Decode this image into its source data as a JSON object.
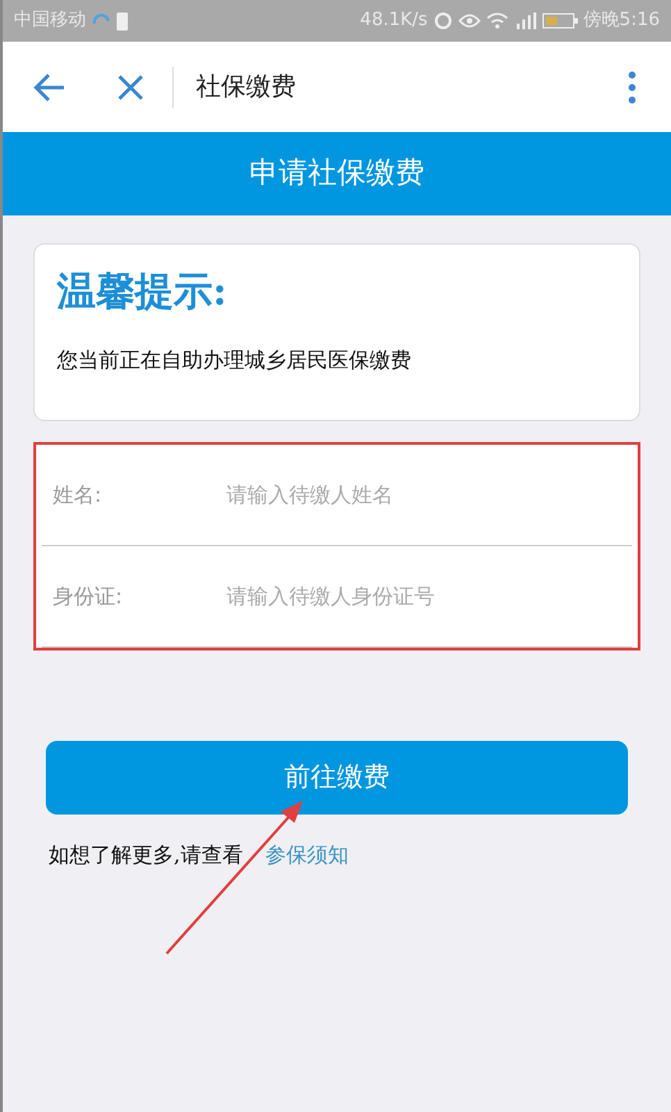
{
  "status_bar": {
    "carrier": "中国移动",
    "speed": "48.1K/s",
    "time": "傍晚5:16"
  },
  "toolbar": {
    "title": "社保缴费"
  },
  "banner": {
    "title": "申请社保缴费"
  },
  "notice": {
    "heading": "温馨提示:",
    "text": "您当前正在自助办理城乡居民医保缴费"
  },
  "form": {
    "fields": [
      {
        "label": "姓名:",
        "placeholder": "请输入待缴人姓名"
      },
      {
        "label": "身份证:",
        "placeholder": "请输入待缴人身份证号"
      }
    ]
  },
  "submit_button": "前往缴费",
  "footer": {
    "text": "如想了解更多,请查看",
    "link": "参保须知"
  }
}
